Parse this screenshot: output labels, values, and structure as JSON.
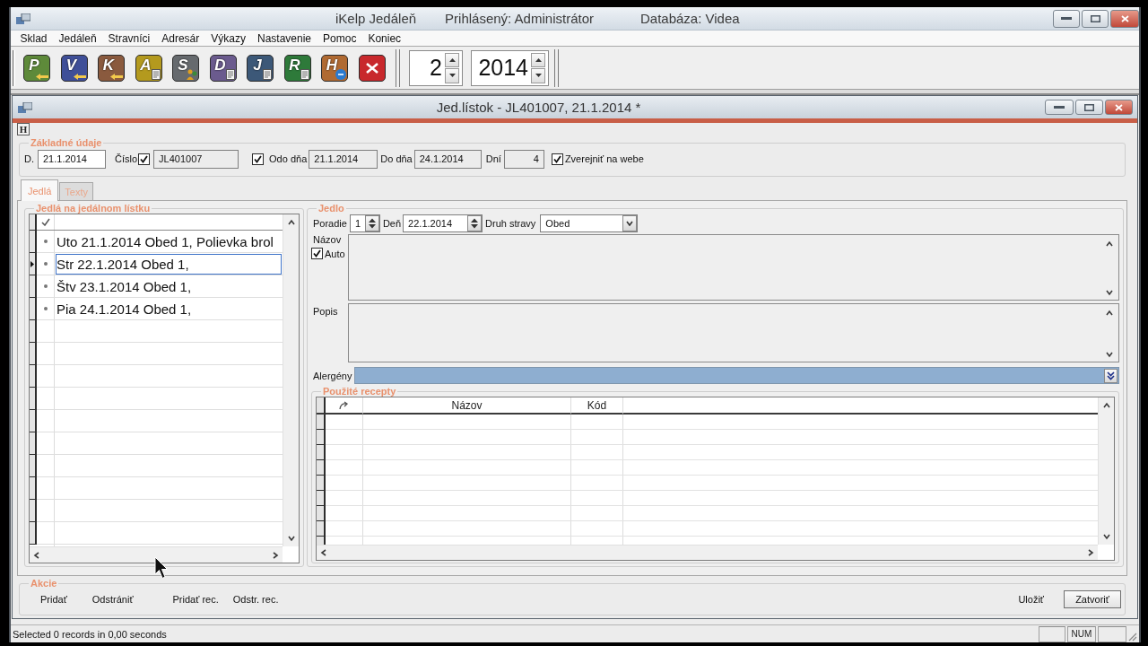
{
  "window": {
    "title": "iKelp Jedáleň",
    "user": "Prihlásený: Administrátor",
    "database": "Databáza: Videa"
  },
  "menu": [
    "Sklad",
    "Jedáleň",
    "Stravníci",
    "Adresár",
    "Výkazy",
    "Nastavenie",
    "Pomoc",
    "Koniec"
  ],
  "toolbar": {
    "buttons": [
      {
        "kind": "letter",
        "letter": "P",
        "color": "#5e8a3a",
        "badge": {
          "kind": "arrow"
        }
      },
      {
        "kind": "letter",
        "letter": "V",
        "color": "#3f4f98",
        "badge": {
          "kind": "arrow"
        }
      },
      {
        "kind": "letter",
        "letter": "K",
        "color": "#8a5a3e",
        "badge": {
          "kind": "arrow"
        }
      },
      {
        "kind": "letter",
        "letter": "A",
        "color": "#b49a1e",
        "badge": {
          "kind": "document"
        }
      },
      {
        "kind": "letter",
        "letter": "S",
        "color": "#666a6e",
        "badge": {
          "kind": "people"
        }
      },
      {
        "kind": "letter",
        "letter": "D",
        "color": "#6b5b8e",
        "badge": {
          "kind": "document"
        }
      },
      {
        "kind": "letter",
        "letter": "J",
        "color": "#3c5878",
        "badge": {
          "kind": "document"
        }
      },
      {
        "kind": "letter",
        "letter": "R",
        "color": "#2e7a3a",
        "badge": {
          "kind": "document"
        }
      },
      {
        "kind": "letter",
        "letter": "H",
        "color": "#b06a32",
        "badge": {
          "kind": "circle"
        }
      },
      {
        "kind": "close",
        "color": "#c8282c"
      }
    ],
    "month": "2",
    "year": "2014"
  },
  "document": {
    "title": "Jed.lístok - JL401007, 21.1.2014 *",
    "header_button": "H"
  },
  "basic": {
    "legend": "Základné údaje",
    "date_label": "D.",
    "date": "21.1.2014",
    "number_label": "Číslo",
    "number_checked": true,
    "number": "JL401007",
    "range_checked": true,
    "from_label": "Odo dňa",
    "from": "21.1.2014",
    "to_label": "Do dňa",
    "to": "24.1.2014",
    "days_label": "Dní",
    "days": "4",
    "publish_checked": true,
    "publish_label": "Zverejniť na webe"
  },
  "tabs": [
    {
      "label": "Jedlá",
      "selected": true
    },
    {
      "label": "Texty",
      "selected": false
    }
  ],
  "meals": {
    "legend": "Jedlá na jedálnom lístku",
    "rows": [
      {
        "text": "Uto 21.1.2014 Obed 1, Polievka brol",
        "selected": false
      },
      {
        "text": "Str 22.1.2014 Obed 1,",
        "selected": true
      },
      {
        "text": "Štv 23.1.2014 Obed 1,",
        "selected": false
      },
      {
        "text": "Pia 24.1.2014 Obed 1,",
        "selected": false
      }
    ]
  },
  "meal": {
    "legend": "Jedlo",
    "order_label": "Poradie",
    "order": "1",
    "day_label": "Deň",
    "day": "22.1.2014",
    "type_label": "Druh stravy",
    "type": "Obed",
    "name_label": "Názov",
    "auto_label": "Auto",
    "auto_checked": true,
    "description_label": "Popis",
    "allergens_label": "Alergény"
  },
  "recipes": {
    "legend": "Použité recepty",
    "columns": [
      "Názov",
      "Kód"
    ]
  },
  "actions": {
    "legend": "Akcie",
    "links": [
      "Pridať",
      "Odstrániť",
      "Pridať rec.",
      "Odstr. rec."
    ],
    "save": "Uložiť",
    "close": "Zatvoriť"
  },
  "status_bar": {
    "message": "Selected 0 records in 0,00 seconds",
    "indicator": "NUM"
  }
}
